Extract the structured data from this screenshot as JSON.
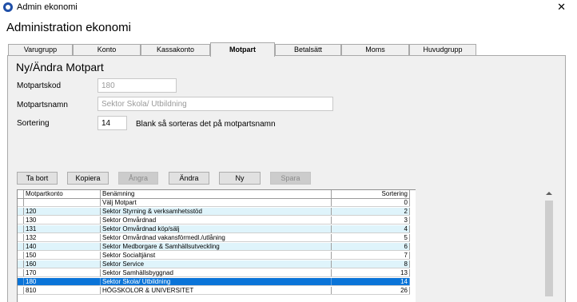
{
  "window": {
    "title": "Admin ekonomi",
    "close_glyph": "✕"
  },
  "app": {
    "title": "Administration ekonomi"
  },
  "tabs": [
    {
      "label": "Varugrupp",
      "active": false
    },
    {
      "label": "Konto",
      "active": false
    },
    {
      "label": "Kassakonto",
      "active": false
    },
    {
      "label": "Motpart",
      "active": true
    },
    {
      "label": "Betalsätt",
      "active": false
    },
    {
      "label": "Moms",
      "active": false
    },
    {
      "label": "Huvudgrupp",
      "active": false
    }
  ],
  "form": {
    "title": "Ny/Ändra Motpart",
    "code_label": "Motpartskod",
    "code_value": "180",
    "name_label": "Motpartsnamn",
    "name_value": "Sektor Skola/ Utbildning",
    "sort_label": "Sortering",
    "sort_value": "14",
    "sort_hint": "Blank så sorteras det på motpartsnamn"
  },
  "buttons": {
    "delete": "Ta bort",
    "copy": "Kopiera",
    "undo": "Ångra",
    "edit": "Ändra",
    "new": "Ny",
    "save": "Spara"
  },
  "grid": {
    "columns": [
      "Motpartkonto",
      "Benämning",
      "Sortering"
    ],
    "rows": [
      {
        "code": "",
        "name": "Välj Motpart",
        "sort": "0"
      },
      {
        "code": "120",
        "name": "Sektor Styrning & verksamhetsstöd",
        "sort": "2"
      },
      {
        "code": "130",
        "name": "Sektor Omvårdnad",
        "sort": "3"
      },
      {
        "code": "131",
        "name": "Sektor Omvårdnad köp/sälj",
        "sort": "4"
      },
      {
        "code": "132",
        "name": "Sektor Omvårdnad vakansförmedl./utlåning",
        "sort": "5"
      },
      {
        "code": "140",
        "name": "Sektor Medborgare & Samhällsutveckling",
        "sort": "6"
      },
      {
        "code": "150",
        "name": "Sektor Socialtjänst",
        "sort": "7"
      },
      {
        "code": "160",
        "name": "Sektor Service",
        "sort": "8"
      },
      {
        "code": "170",
        "name": "Sektor Samhällsbyggnad",
        "sort": "13"
      },
      {
        "code": "180",
        "name": "Sektor Skola/ Utbildning",
        "sort": "14"
      },
      {
        "code": "810",
        "name": "HÖGSKOLOR & UNIVERSITET",
        "sort": "26"
      }
    ]
  }
}
